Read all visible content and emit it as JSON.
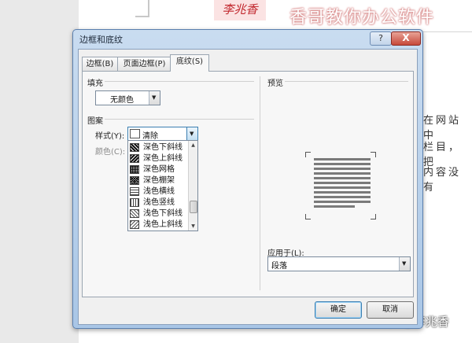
{
  "background": {
    "stamp_text": "李兆香",
    "watermark_top": "香哥教你办公软件",
    "doc_lines": [
      "在网站中",
      "栏目，把",
      "内容没有"
    ],
    "watermark_bottom": "知乎 @李兆香"
  },
  "dialog": {
    "title": "边框和底纹",
    "help_label": "?",
    "close_label": "X",
    "tabs": [
      {
        "label": "边框(B)",
        "active": false
      },
      {
        "label": "页面边框(P)",
        "active": false
      },
      {
        "label": "底纹(S)",
        "active": true
      }
    ],
    "fill": {
      "section_label": "填充",
      "value": "无颜色"
    },
    "pattern": {
      "section_label": "图案",
      "style_label": "样式(Y):",
      "style_value": "清除",
      "color_label": "颜色(C):",
      "options": [
        "深色下斜线",
        "深色上斜线",
        "深色网格",
        "深色棚架",
        "浅色横线",
        "浅色竖线",
        "浅色下斜线",
        "浅色上斜线"
      ]
    },
    "preview": {
      "section_label": "预览",
      "apply_label": "应用于(L):",
      "apply_value": "段落"
    },
    "buttons": {
      "ok": "确定",
      "cancel": "取消"
    }
  }
}
